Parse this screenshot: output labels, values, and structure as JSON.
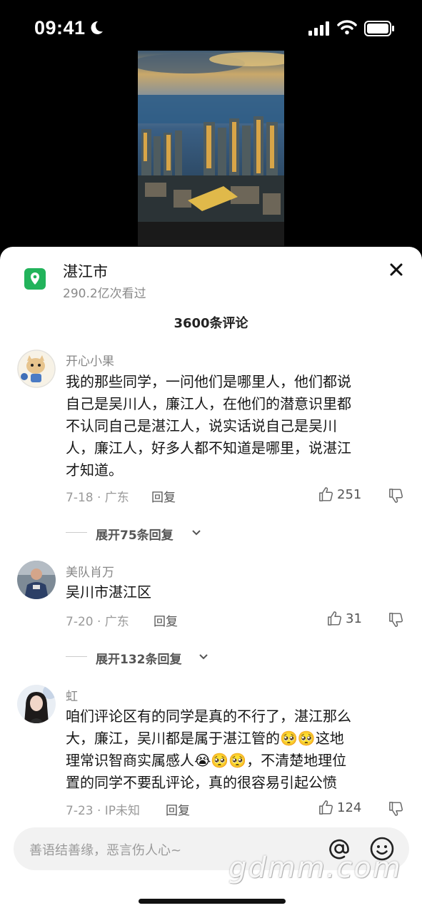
{
  "status_bar": {
    "time": "09:41"
  },
  "location": {
    "title": "湛江市",
    "views": "290.2亿次看过"
  },
  "comments": {
    "count_label": "3600条评论",
    "items": [
      {
        "user": "开心小果",
        "lines": [
          "我的那些同学，一问他们是哪里人，他们都说",
          "自己是吴川人，廉江人，在他们的潜意识里都",
          "不认同自己是湛江人，说实话说自己是吴川",
          "人，廉江人，好多人都不知道是哪里，说湛江",
          "才知道。"
        ],
        "meta": "7-18 · 广东",
        "reply": "回复",
        "likes": "251",
        "expand": "展开75条回复"
      },
      {
        "user": "美队肖万",
        "lines": [
          "吴川市湛江区"
        ],
        "meta": "7-20 · 广东",
        "reply": "回复",
        "likes": "31",
        "expand": "展开132条回复"
      },
      {
        "user": "虹",
        "lines": [
          "咱们评论区有的同学是真的不行了，湛江那么",
          "大，廉江，吴川都是属于湛江管的",
          "理常识智商实属感人",
          "置的同学不要乱评论，真的很容易引起公愤"
        ],
        "line2_tail": "这地",
        "line3_tail": "，不清楚地理位",
        "meta": "7-23 · IP未知",
        "reply": "回复",
        "likes": "124"
      }
    ]
  },
  "input": {
    "placeholder": "善语结善缘，恶言伤人心~"
  },
  "watermark": "gdmm.com",
  "colors": {
    "accent_green": "#22b35b",
    "sheet_bg": "#ffffff",
    "screen_bg": "#000000"
  },
  "icons": [
    "moon-icon",
    "signal-icon",
    "wifi-icon",
    "battery-icon",
    "location-pin-icon",
    "close-icon",
    "thumbs-up-icon",
    "thumbs-down-icon",
    "chevron-down-icon",
    "at-icon",
    "emoji-icon"
  ]
}
